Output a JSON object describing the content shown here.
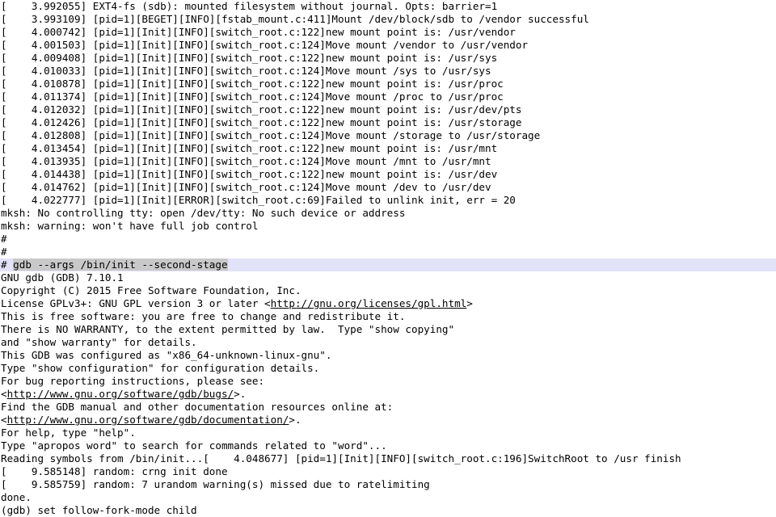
{
  "terminal": {
    "title": "Terminal — boot log / gdb session",
    "colors": {
      "background": "#ffffff",
      "foreground": "#000000",
      "row_highlight": "#e2e2f8",
      "selection": "#c9c9c9"
    },
    "lines": [
      {
        "text": "[    3.992055] EXT4-fs (sdb): mounted filesystem without journal. Opts: barrier=1"
      },
      {
        "text": "[    3.993109] [pid=1][BEGET][INFO][fstab_mount.c:411]Mount /dev/block/sdb to /vendor successful"
      },
      {
        "text": "[    4.000742] [pid=1][Init][INFO][switch_root.c:122]new mount point is: /usr/vendor"
      },
      {
        "text": "[    4.001503] [pid=1][Init][INFO][switch_root.c:124]Move mount /vendor to /usr/vendor"
      },
      {
        "text": "[    4.009408] [pid=1][Init][INFO][switch_root.c:122]new mount point is: /usr/sys"
      },
      {
        "text": "[    4.010033] [pid=1][Init][INFO][switch_root.c:124]Move mount /sys to /usr/sys"
      },
      {
        "text": "[    4.010878] [pid=1][Init][INFO][switch_root.c:122]new mount point is: /usr/proc"
      },
      {
        "text": "[    4.011374] [pid=1][Init][INFO][switch_root.c:124]Move mount /proc to /usr/proc"
      },
      {
        "text": "[    4.012032] [pid=1][Init][INFO][switch_root.c:122]new mount point is: /usr/dev/pts"
      },
      {
        "text": "[    4.012426] [pid=1][Init][INFO][switch_root.c:122]new mount point is: /usr/storage"
      },
      {
        "text": "[    4.012808] [pid=1][Init][INFO][switch_root.c:124]Move mount /storage to /usr/storage"
      },
      {
        "text": "[    4.013454] [pid=1][Init][INFO][switch_root.c:122]new mount point is: /usr/mnt"
      },
      {
        "text": "[    4.013935] [pid=1][Init][INFO][switch_root.c:124]Move mount /mnt to /usr/mnt"
      },
      {
        "text": "[    4.014438] [pid=1][Init][INFO][switch_root.c:122]new mount point is: /usr/dev"
      },
      {
        "text": "[    4.014762] [pid=1][Init][INFO][switch_root.c:124]Move mount /dev to /usr/dev"
      },
      {
        "text": "[    4.022777] [pid=1][Init][ERROR][switch_root.c:69]Failed to unlink init, err = 20"
      },
      {
        "text": "mksh: No controlling tty: open /dev/tty: No such device or address"
      },
      {
        "text": "mksh: warning: won't have full job control"
      },
      {
        "text": "#"
      },
      {
        "text": "#"
      },
      {
        "prompt": "# ",
        "selected": "gdb --args /bin/init --second-stage",
        "highlight": true
      },
      {
        "text": "GNU gdb (GDB) 7.10.1"
      },
      {
        "text": "Copyright (C) 2015 Free Software Foundation, Inc."
      },
      {
        "pre": "License GPLv3+: GNU GPL version 3 or later <",
        "url": "http://gnu.org/licenses/gpl.html",
        "post": ">"
      },
      {
        "text": "This is free software: you are free to change and redistribute it."
      },
      {
        "text": "There is NO WARRANTY, to the extent permitted by law.  Type \"show copying\""
      },
      {
        "text": "and \"show warranty\" for details."
      },
      {
        "text": "This GDB was configured as \"x86_64-unknown-linux-gnu\"."
      },
      {
        "text": "Type \"show configuration\" for configuration details."
      },
      {
        "text": "For bug reporting instructions, please see:"
      },
      {
        "pre": "<",
        "url": "http://www.gnu.org/software/gdb/bugs/",
        "post": ">."
      },
      {
        "text": "Find the GDB manual and other documentation resources online at:"
      },
      {
        "pre": "<",
        "url": "http://www.gnu.org/software/gdb/documentation/",
        "post": ">."
      },
      {
        "text": "For help, type \"help\"."
      },
      {
        "text": "Type \"apropos word\" to search for commands related to \"word\"..."
      },
      {
        "text": "Reading symbols from /bin/init...[    4.048677] [pid=1][Init][INFO][switch_root.c:196]SwitchRoot to /usr finish"
      },
      {
        "text": "[    9.585148] random: crng init done"
      },
      {
        "text": "[    9.585759] random: 7 urandom warning(s) missed due to ratelimiting"
      },
      {
        "text": "done."
      },
      {
        "text": "(gdb) set follow-fork-mode child"
      }
    ]
  }
}
